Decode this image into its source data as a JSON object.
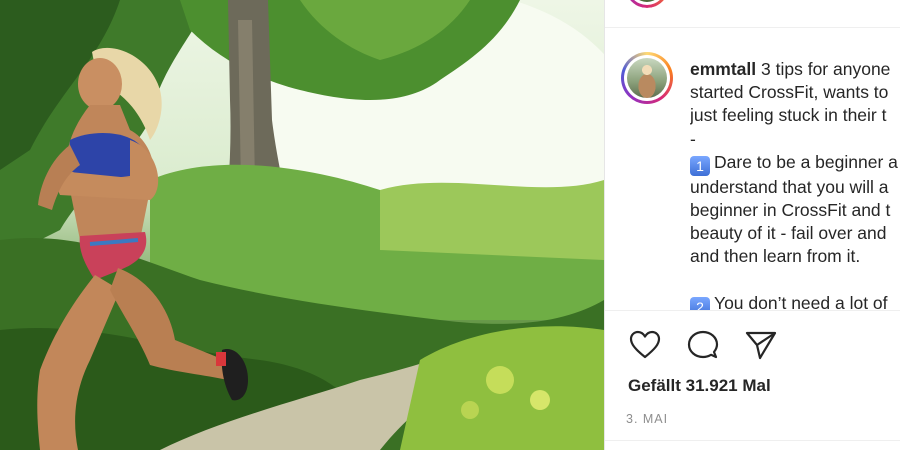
{
  "post": {
    "username": "emmtall",
    "caption_lines": [
      "3 tips for anyone",
      "started CrossFit, wants to",
      "just feeling stuck in their t",
      "-",
      "Dare to be a beginner a",
      "understand that you will a",
      "beginner in CrossFit and t",
      "beauty of it - fail over and",
      "and then learn from it.",
      "",
      "You don’t need a lot of"
    ],
    "keycap_1": "1",
    "keycap_2": "2",
    "likes": "Gefällt 31.921 Mal",
    "date": "3. MAI"
  },
  "icons": {
    "like": "heart-icon",
    "comment": "comment-icon",
    "share": "paper-plane-icon"
  },
  "colors": {
    "text": "#262626",
    "muted": "#8e8e8e",
    "divider": "#efefef",
    "story_ring": [
      "#feda75",
      "#fa7e1e",
      "#d62976",
      "#962fbf"
    ]
  }
}
